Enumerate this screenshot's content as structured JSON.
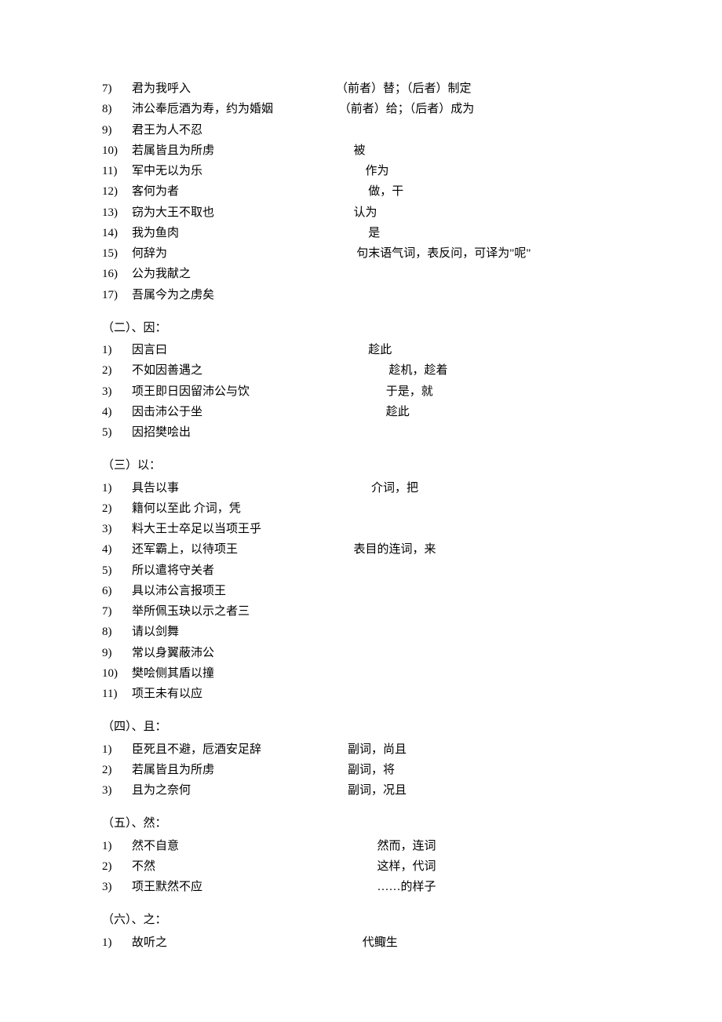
{
  "sections": [
    {
      "heading": null,
      "items": [
        {
          "n": "7)",
          "sent": "君为我呼入",
          "gloss": "（前者）替；（后者）制定"
        },
        {
          "n": "8)",
          "sent": "沛公奉卮酒为寿，约为婚姻",
          "gloss": " （前者）给；（后者）成为"
        },
        {
          "n": "9)",
          "sent": "君王为人不忍",
          "gloss": ""
        },
        {
          "n": "10)",
          "sent": "若属皆且为所虏",
          "gloss": "      被"
        },
        {
          "n": "11)",
          "sent": "军中无以为乐",
          "gloss": "          作为"
        },
        {
          "n": "12)",
          "sent": "客何为者",
          "gloss": "           做，干"
        },
        {
          "n": "13)",
          "sent": "窃为大王不取也",
          "gloss": "      认为"
        },
        {
          "n": "14)",
          "sent": "我为鱼肉",
          "gloss": "           是"
        },
        {
          "n": "15)",
          "sent": "何辞为",
          "gloss": "       句末语气词，表反问，可译为\"呢\""
        },
        {
          "n": "16)",
          "sent": "公为我献之",
          "gloss": ""
        },
        {
          "n": "17)",
          "sent": "吾属今为之虏矣",
          "gloss": ""
        }
      ]
    },
    {
      "heading": "（二）、因：",
      "items": [
        {
          "n": "1)",
          "sent": "因言曰",
          "gloss": "           趁此"
        },
        {
          "n": "2)",
          "sent": "不如因善遇之",
          "gloss": "                  趁机，趁着"
        },
        {
          "n": "3)",
          "sent": "项王即日因留沛公与饮",
          "gloss": "                 于是，就"
        },
        {
          "n": "4)",
          "sent": "因击沛公于坐",
          "gloss": "                 趁此"
        },
        {
          "n": "5)",
          "sent": "因招樊哙出",
          "gloss": ""
        }
      ]
    },
    {
      "heading": "（三）以：",
      "items": [
        {
          "n": "1)",
          "sent": "具告以事",
          "gloss": "            介词，把"
        },
        {
          "n": "2)",
          "sent": "籍何以至此     介词，凭",
          "gloss": ""
        },
        {
          "n": "3)",
          "sent": "料大王士卒足以当项王乎",
          "gloss": ""
        },
        {
          "n": "4)",
          "sent": "还军霸上，以待项王",
          "gloss": "      表目的连词，来"
        },
        {
          "n": "5)",
          "sent": "所以遣将守关者",
          "gloss": ""
        },
        {
          "n": "6)",
          "sent": "具以沛公言报项王",
          "gloss": ""
        },
        {
          "n": "7)",
          "sent": "举所佩玉玦以示之者三",
          "gloss": ""
        },
        {
          "n": "8)",
          "sent": "请以剑舞",
          "gloss": ""
        },
        {
          "n": "9)",
          "sent": "常以身翼蔽沛公",
          "gloss": ""
        },
        {
          "n": "10)",
          "sent": "樊哙侧其盾以撞",
          "gloss": ""
        },
        {
          "n": "11)",
          "sent": "项王未有以应",
          "gloss": ""
        }
      ]
    },
    {
      "heading": "（四）、且：",
      "items": [
        {
          "n": "1)",
          "sent": "臣死且不避，卮酒安足辞",
          "gloss": "    副词，尚且"
        },
        {
          "n": "2)",
          "sent": "若属皆且为所虏",
          "gloss": "    副词，将"
        },
        {
          "n": "3)",
          "sent": "且为之奈何",
          "gloss": "    副词，况且"
        }
      ]
    },
    {
      "heading": "（五）、然：",
      "items": [
        {
          "n": "1)",
          "sent": "然不自意",
          "gloss": "              然而，连词"
        },
        {
          "n": "2)",
          "sent": "不然",
          "gloss": "              这样，代词"
        },
        {
          "n": "3)",
          "sent": "项王默然不应",
          "gloss": "              ……的样子"
        }
      ]
    },
    {
      "heading": "（六）、之：",
      "items": [
        {
          "n": "1)",
          "sent": "故听之",
          "gloss": "         代鲰生"
        }
      ]
    }
  ]
}
